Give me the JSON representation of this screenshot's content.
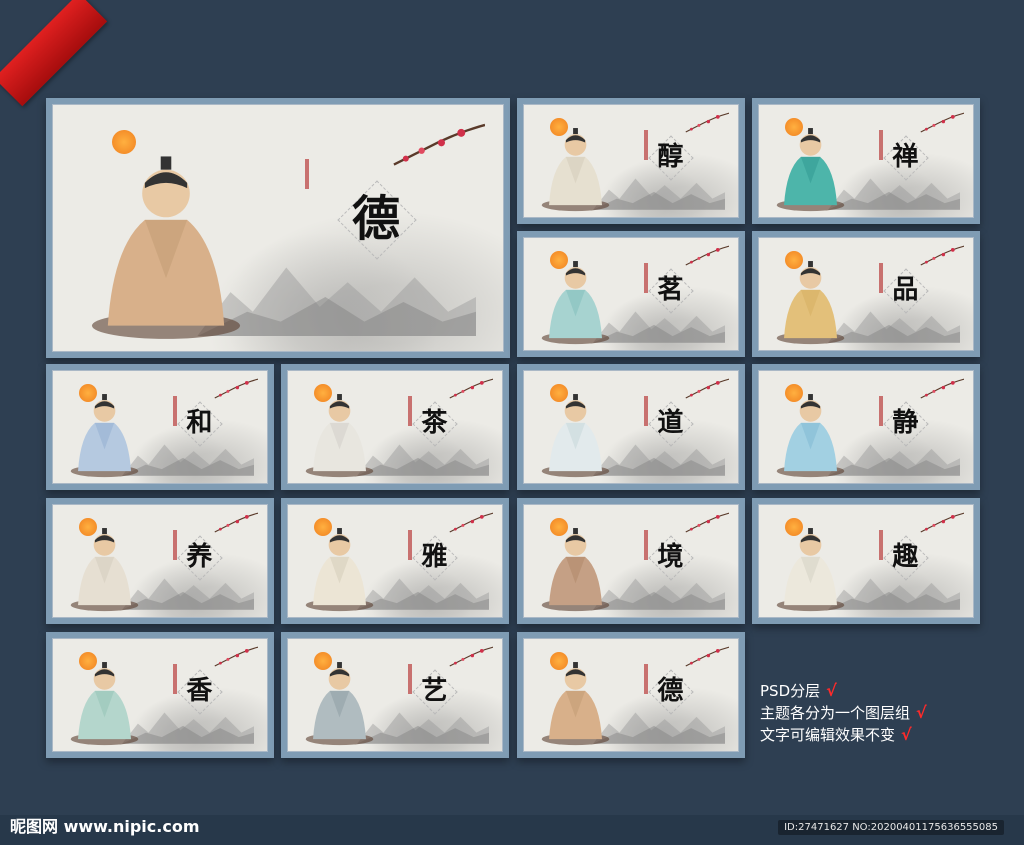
{
  "panels": [
    {
      "char": "德",
      "figure_color": "#c9a27a",
      "robe": "#d8b08a"
    },
    {
      "char": "醇",
      "figure_color": "#d9d2c0",
      "robe": "#e6e0d0"
    },
    {
      "char": "禅",
      "figure_color": "#3ba39a",
      "robe": "#4db5aa"
    },
    {
      "char": "茗",
      "figure_color": "#8ec5c2",
      "robe": "#a7d3d0"
    },
    {
      "char": "品",
      "figure_color": "#d9b46a",
      "robe": "#e3c07a"
    },
    {
      "char": "和",
      "figure_color": "#9fb8d6",
      "robe": "#b5c9e0"
    },
    {
      "char": "茶",
      "figure_color": "#d8d6cf",
      "robe": "#e8e6df"
    },
    {
      "char": "道",
      "figure_color": "#cfdde0",
      "robe": "#e2eaec"
    },
    {
      "char": "静",
      "figure_color": "#8cc0d8",
      "robe": "#a2d0e2"
    },
    {
      "char": "养",
      "figure_color": "#d9d2c4",
      "robe": "#e6dfd2"
    },
    {
      "char": "雅",
      "figure_color": "#dcd4c2",
      "robe": "#ece5d5"
    },
    {
      "char": "境",
      "figure_color": "#b79072",
      "robe": "#c5a085"
    },
    {
      "char": "趣",
      "figure_color": "#dcd8cc",
      "robe": "#ece8dc"
    },
    {
      "char": "香",
      "figure_color": "#9fc9bd",
      "robe": "#b4d6cc"
    },
    {
      "char": "艺",
      "figure_color": "#9aa8ad",
      "robe": "#b0bcc0"
    },
    {
      "char": "德",
      "figure_color": "#c9a27a",
      "robe": "#d8b08a"
    }
  ],
  "info": {
    "line1": "PSD分层",
    "line2": "主题各分为一个图层组",
    "line3": "文字可编辑效果不变",
    "check": "√"
  },
  "footer": {
    "logo": "昵图网 www.nipic.com",
    "id": "ID:27471627 NO:20200401175636555085"
  },
  "colors": {
    "background": "#2e3f52",
    "frame": "#7f9cb4",
    "paper": "#ecebe6",
    "accent_red": "#ff2a2a"
  }
}
